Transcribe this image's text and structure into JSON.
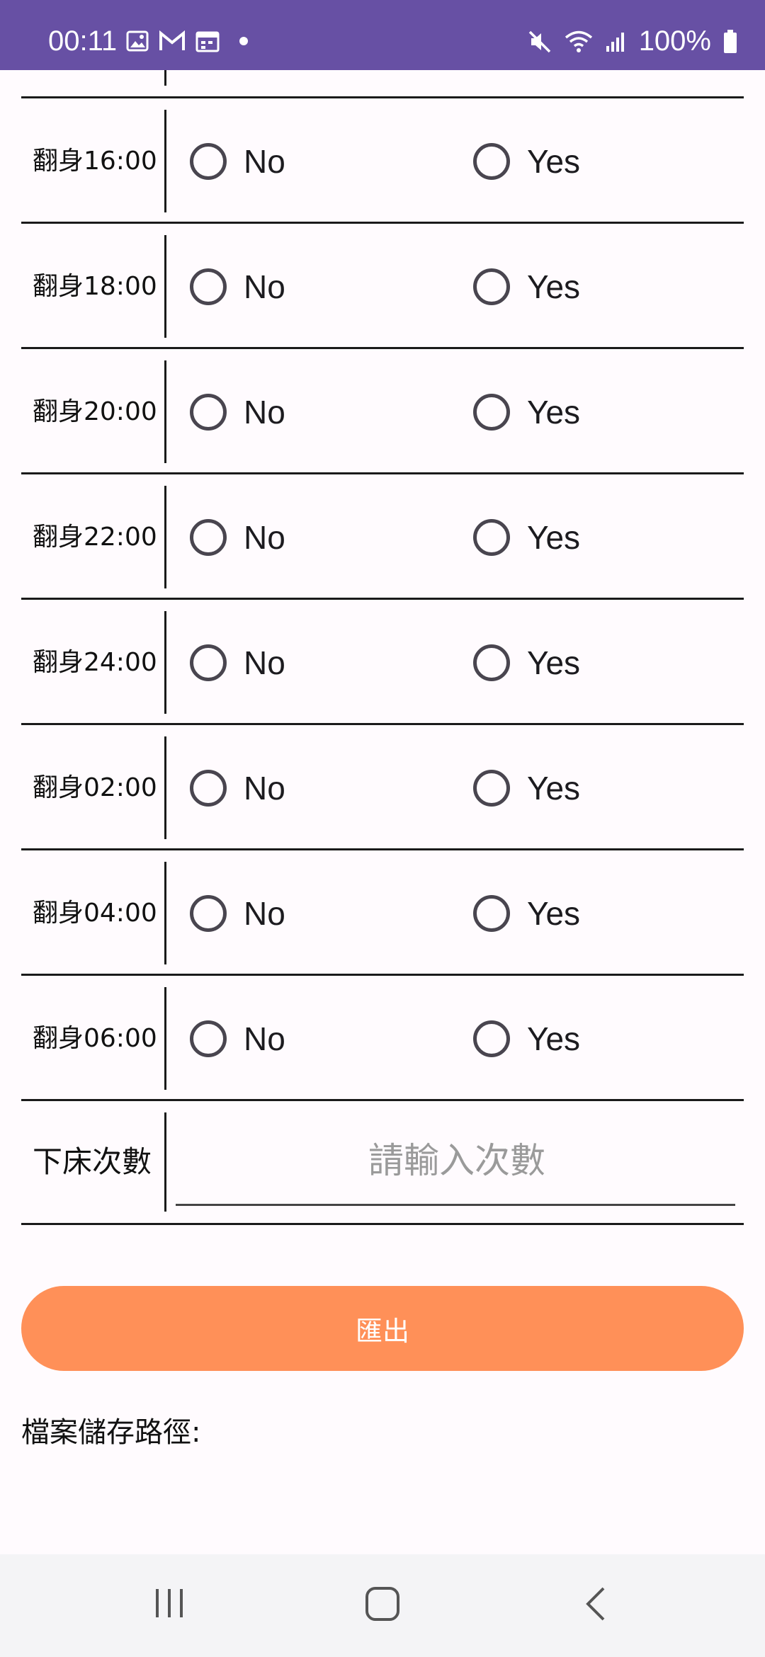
{
  "status_bar": {
    "time": "00:11",
    "battery": "100%",
    "icons_left": [
      "photo-icon",
      "gmail-icon",
      "calendar-icon",
      "dot-icon"
    ],
    "icons_right": [
      "mute-icon",
      "wifi-icon",
      "signal-icon",
      "battery-icon"
    ]
  },
  "rows": [
    {
      "label": "翻身16:00",
      "no": "No",
      "yes": "Yes"
    },
    {
      "label": "翻身18:00",
      "no": "No",
      "yes": "Yes"
    },
    {
      "label": "翻身20:00",
      "no": "No",
      "yes": "Yes"
    },
    {
      "label": "翻身22:00",
      "no": "No",
      "yes": "Yes"
    },
    {
      "label": "翻身24:00",
      "no": "No",
      "yes": "Yes"
    },
    {
      "label": "翻身02:00",
      "no": "No",
      "yes": "Yes"
    },
    {
      "label": "翻身04:00",
      "no": "No",
      "yes": "Yes"
    },
    {
      "label": "翻身06:00",
      "no": "No",
      "yes": "Yes"
    }
  ],
  "bed_exit": {
    "label": "下床次數",
    "placeholder": "請輸入次數",
    "value": ""
  },
  "export_button": "匯出",
  "file_path_label": "檔案儲存路徑:",
  "colors": {
    "status_bar": "#6750a4",
    "export_button": "#ff9058"
  }
}
